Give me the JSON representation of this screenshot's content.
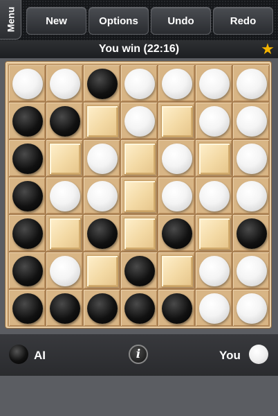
{
  "toolbar": {
    "menu_label": "Menu",
    "buttons": [
      "New",
      "Options",
      "Undo",
      "Redo"
    ]
  },
  "status": {
    "message": "You win (22:16)",
    "star_icon": "star-icon"
  },
  "board": {
    "size": 7,
    "legend": {
      "B": "black stone",
      "W": "white stone",
      "X": "blocked square"
    },
    "rows": [
      [
        "W",
        "W",
        "B",
        "W",
        "W",
        "W",
        "W"
      ],
      [
        "B",
        "B",
        "X",
        "W",
        "X",
        "W",
        "W"
      ],
      [
        "B",
        "X",
        "W",
        "X",
        "W",
        "X",
        "W"
      ],
      [
        "B",
        "W",
        "W",
        "X",
        "W",
        "W",
        "W"
      ],
      [
        "B",
        "X",
        "B",
        "X",
        "B",
        "X",
        "B"
      ],
      [
        "B",
        "W",
        "X",
        "B",
        "X",
        "W",
        "W"
      ],
      [
        "B",
        "B",
        "B",
        "B",
        "B",
        "W",
        "W"
      ]
    ]
  },
  "footer": {
    "player_ai": "AI",
    "player_you": "You",
    "info_icon": "info-icon"
  },
  "colors": {
    "board_wood": "#d8b585",
    "block_wood": "#f3d9a4",
    "star": "#f4b400",
    "toolbar_bg": "#15171a"
  }
}
